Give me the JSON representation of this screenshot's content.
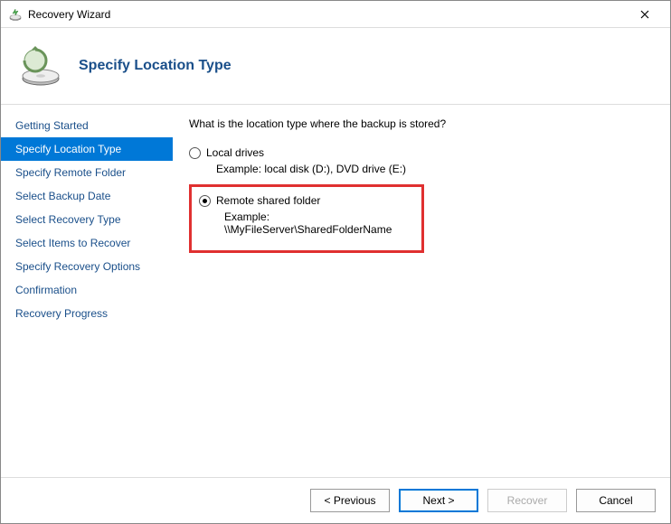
{
  "window": {
    "title": "Recovery Wizard"
  },
  "header": {
    "title": "Specify Location Type"
  },
  "sidebar": {
    "items": [
      {
        "label": "Getting Started"
      },
      {
        "label": "Specify Location Type"
      },
      {
        "label": "Specify Remote Folder"
      },
      {
        "label": "Select Backup Date"
      },
      {
        "label": "Select Recovery Type"
      },
      {
        "label": "Select Items to Recover"
      },
      {
        "label": "Specify Recovery Options"
      },
      {
        "label": "Confirmation"
      },
      {
        "label": "Recovery Progress"
      }
    ],
    "active_index": 1
  },
  "main": {
    "question": "What is the location type where the backup is stored?",
    "options": [
      {
        "label": "Local drives",
        "example": "Example: local disk (D:), DVD drive (E:)",
        "checked": false
      },
      {
        "label": "Remote shared folder",
        "example": "Example: \\\\MyFileServer\\SharedFolderName",
        "checked": true
      }
    ]
  },
  "footer": {
    "previous": "< Previous",
    "next": "Next >",
    "recover": "Recover",
    "cancel": "Cancel"
  }
}
